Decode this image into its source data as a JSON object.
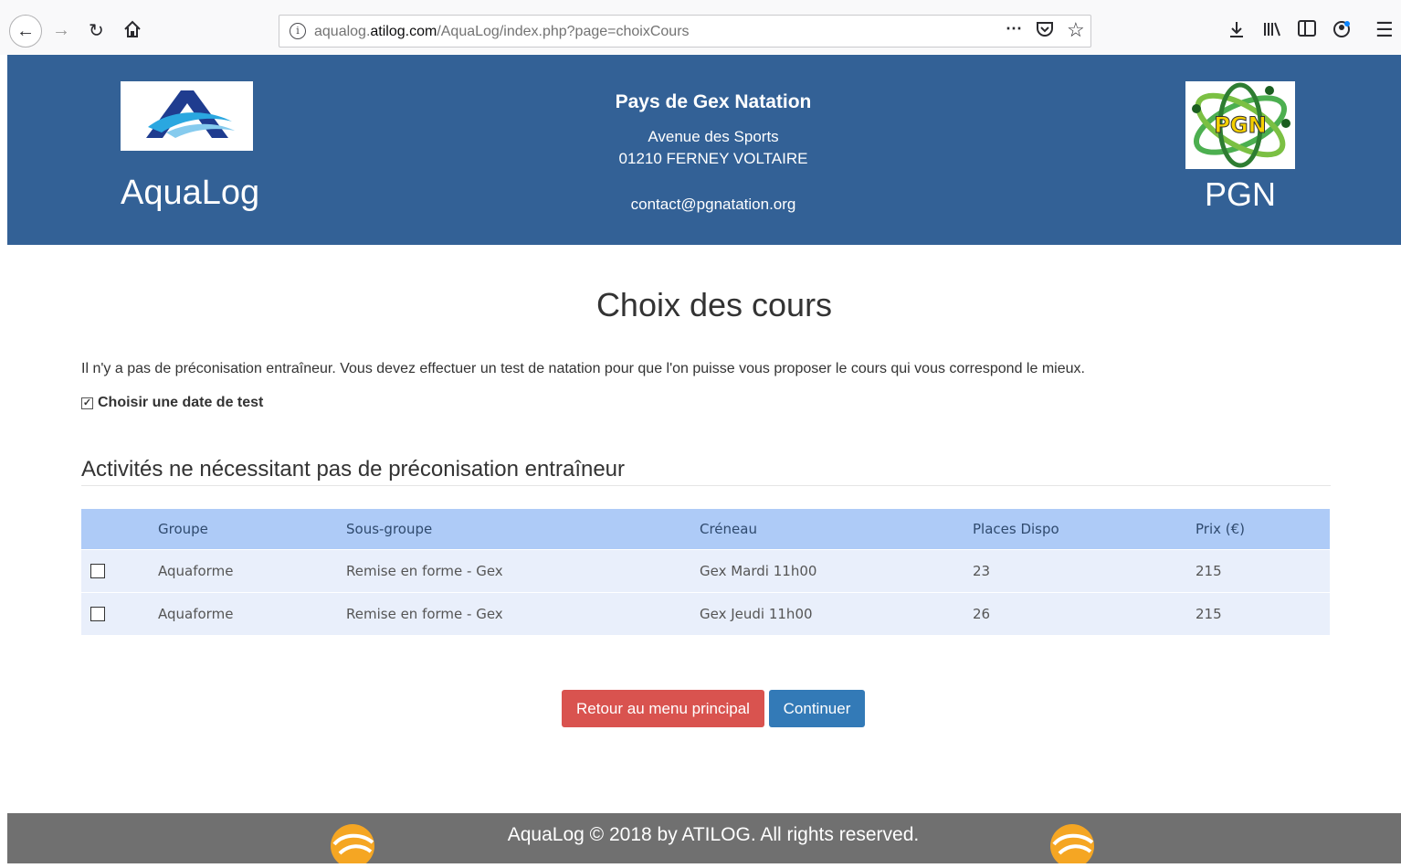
{
  "browser": {
    "url_prefix": "aqualog.",
    "url_host": "atilog.com",
    "url_path": "/AquaLog/index.php?page=choixCours",
    "icons": [
      "back-icon",
      "forward-icon",
      "reload-icon",
      "home-icon",
      "info-icon",
      "more-icon",
      "pocket-icon",
      "bookmark-star-icon",
      "download-icon",
      "library-icon",
      "sidebar-icon",
      "account-icon",
      "menu-icon"
    ]
  },
  "header": {
    "app_name": "AquaLog",
    "club_name": "Pays de Gex Natation",
    "address_line1": "Avenue des Sports",
    "address_line2": "01210 FERNEY VOLTAIRE",
    "email": "contact@pgnatation.org",
    "club_logo_text": "PGN",
    "club_short": "PGN",
    "bg_color": "#336196"
  },
  "main": {
    "title": "Choix des cours",
    "intro": "Il n'y a pas de préconisation entraîneur. Vous devez effectuer un test de natation pour que l'on puisse vous proposer le cours qui vous correspond le mieux.",
    "test_checkbox_label": "Choisir une date de test",
    "test_checkbox_checked": true,
    "section_title": "Activités ne nécessitant pas de préconisation entraîneur",
    "table": {
      "headers": [
        "Groupe",
        "Sous-groupe",
        "Créneau",
        "Places Dispo",
        "Prix (€)"
      ],
      "rows": [
        {
          "groupe": "Aquaforme",
          "sous_groupe": "Remise en forme - Gex",
          "creneau": "Gex Mardi 11h00",
          "places": "23",
          "prix": "215",
          "checked": false
        },
        {
          "groupe": "Aquaforme",
          "sous_groupe": "Remise en forme - Gex",
          "creneau": "Gex Jeudi 11h00",
          "places": "26",
          "prix": "215",
          "checked": false
        }
      ]
    },
    "buttons": {
      "back_label": "Retour au menu principal",
      "continue_label": "Continuer"
    }
  },
  "footer": {
    "text": "AquaLog © 2018 by ATILOG. All rights reserved."
  }
}
